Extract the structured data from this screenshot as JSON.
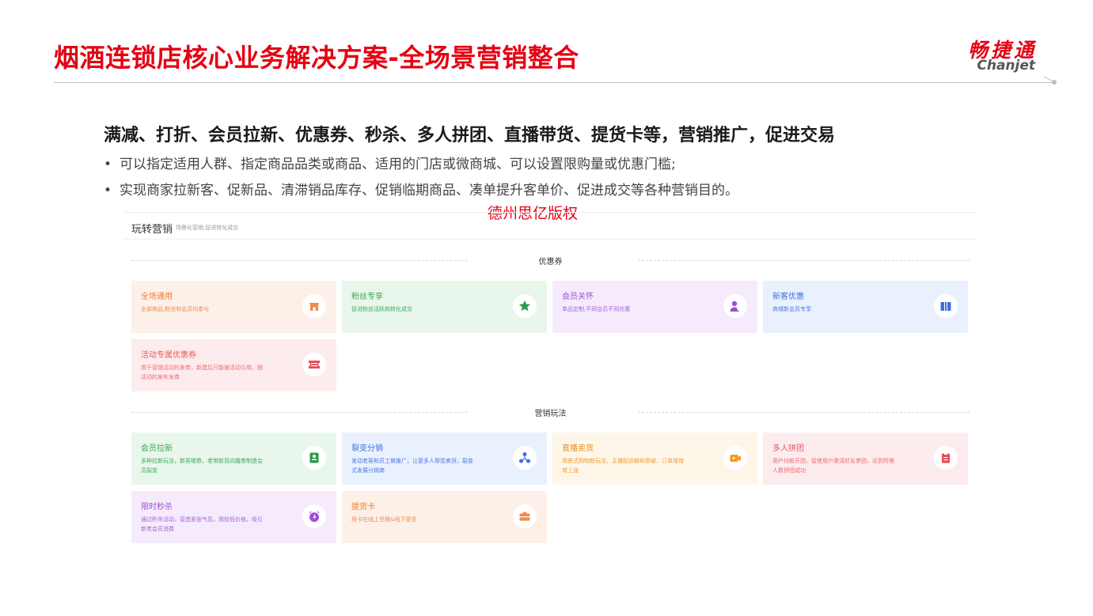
{
  "header": {
    "title": "烟酒连锁店核心业务解决方案-全场景营销整合",
    "logo_cn": "畅捷通",
    "logo_en": "Chanjet"
  },
  "intro": {
    "headline": "满减、打折、会员拉新、优惠券、秒杀、多人拼团、直播带货、提货卡等，营销推广，促进交易",
    "bullet_symbol": "•",
    "bullets": [
      "可以指定适用人群、指定商品品类或商品、适用的门店或微商城、可以设置限购量或优惠门槛;",
      "实现商家拉新客、促新品、清滞销品库存、促销临期商品、凑单提升客单价、促进成交等各种营销目的。"
    ]
  },
  "watermark": "德州思亿版权",
  "panel": {
    "title": "玩转营销",
    "subtitle": "场景化营销,促进转化成交",
    "sections": [
      {
        "label": "优惠券",
        "cards": [
          {
            "title": "全场通用",
            "desc": "全部商品,粉丝和会员均参与",
            "icon": "shop-icon",
            "theme": "orange"
          },
          {
            "title": "粉丝专享",
            "desc": "促进粉丝活跃和转化成交",
            "icon": "star-icon",
            "theme": "green"
          },
          {
            "title": "会员关怀",
            "desc": "单品定制,不同会员不同优惠",
            "icon": "member-icon",
            "theme": "purple"
          },
          {
            "title": "新客优惠",
            "desc": "商城新会员专享",
            "icon": "gift-icon",
            "theme": "blue"
          },
          {
            "title": "活动专属优惠券",
            "desc": "用于营销活动的发券，新建后只能被活动引用，随活动的发布发券",
            "icon": "ticket-icon",
            "theme": "red"
          }
        ]
      },
      {
        "label": "营销玩法",
        "cards": [
          {
            "title": "会员拉新",
            "desc": "多种拉新玩法，新客赠券，老带新双向魔券制造会员裂变",
            "icon": "member-card-icon",
            "theme": "green"
          },
          {
            "title": "裂变分销",
            "desc": "发动老客和员工做推广，让更多人帮您卖货，裂变式发展分销商",
            "icon": "network-icon",
            "theme": "blue"
          },
          {
            "title": "直播卖货",
            "desc": "场景式购物新玩法，主播配讲解和答疑，订单增增增上涨",
            "icon": "live-icon",
            "theme": "yellow"
          },
          {
            "title": "多人拼团",
            "desc": "用户付款开团，促使用户邀请好友参团，达到所需人数拼团成功",
            "icon": "group-icon",
            "theme": "red"
          },
          {
            "title": "限时秒杀",
            "desc": "通过秒杀活动，营造紧张气氛，用较低价格，吸引新老会员消费",
            "icon": "clock-icon",
            "theme": "purple"
          },
          {
            "title": "提货卡",
            "desc": "用卡在线上兑换&线下提货",
            "icon": "card-icon",
            "theme": "orange"
          }
        ]
      }
    ]
  },
  "themes": {
    "orange": {
      "bg": "#fdf0e8",
      "title": "#ef7d2f",
      "desc": "#f08b4b",
      "icon": "#f08b4b"
    },
    "green": {
      "bg": "#e9f6ec",
      "title": "#36a853",
      "desc": "#3cab58",
      "icon": "#2e9a4b"
    },
    "purple": {
      "bg": "#f5ebfd",
      "title": "#a04ed6",
      "desc": "#a566d8",
      "icon": "#a04ed6"
    },
    "blue": {
      "bg": "#eaf1fe",
      "title": "#3d6fe0",
      "desc": "#4a78e0",
      "icon": "#3d6fe0"
    },
    "red": {
      "bg": "#fdeced",
      "title": "#ea5860",
      "desc": "#ee6a70",
      "icon": "#ea4a55"
    },
    "yellow": {
      "bg": "#fef7e9",
      "title": "#f08a18",
      "desc": "#f39a2d",
      "icon": "#f59a1b"
    }
  },
  "colors": {
    "accent": "#e60012"
  }
}
